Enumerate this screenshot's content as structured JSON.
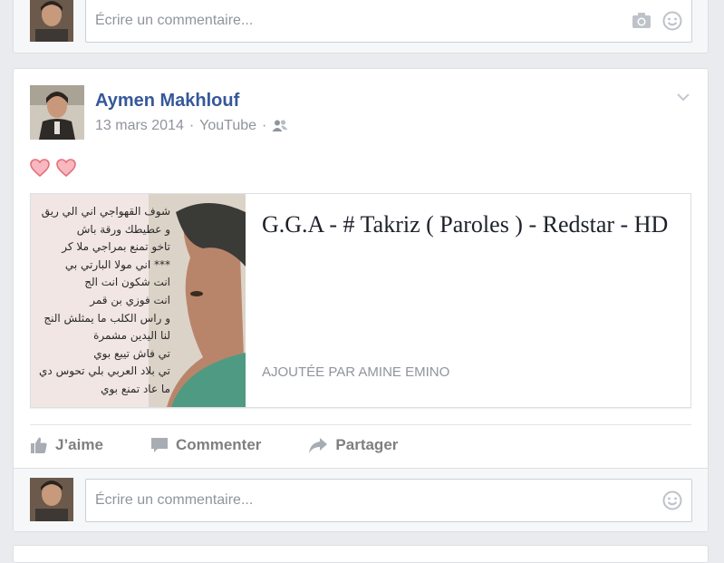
{
  "top_comment": {
    "placeholder": "Écrire un commentaire...",
    "icons": [
      "camera-icon",
      "smiley-icon"
    ]
  },
  "post": {
    "author": "Aymen Makhlouf",
    "date": "13 mars 2014",
    "separator": "·",
    "source": "YouTube",
    "audience_icon": "friends-icon",
    "text": "♡♡",
    "attachment": {
      "title": "G.G.A - # Takriz ( Paroles ) - Redstar - HD",
      "added_by": "AJOUTÉE PAR AMINE EMINO",
      "thumbnail_lines": [
        "شوف القهواجي اني الي ريق",
        "و عطيطك ورقة باش",
        "تاخو تمنع بمراجي ملا كر",
        "*** اني مولا البارتي بي",
        "انت شكون انت الج",
        "انت فوزي بن قمر",
        "و راس الكلب ما يمثلش النج",
        "لنا اليدين مشمرة",
        "تي فاش تيبع بوي",
        "تي بلاد العربي بلي تحوس دي",
        "ما عاد تمنع بوي"
      ]
    },
    "actions": {
      "like": "J’aime",
      "comment": "Commenter",
      "share": "Partager"
    },
    "comment_placeholder": "Écrire un commentaire..."
  },
  "colors": {
    "author_link": "#365899",
    "muted": "#90949c",
    "background": "#e9ebee",
    "heart": "#e9707a"
  }
}
